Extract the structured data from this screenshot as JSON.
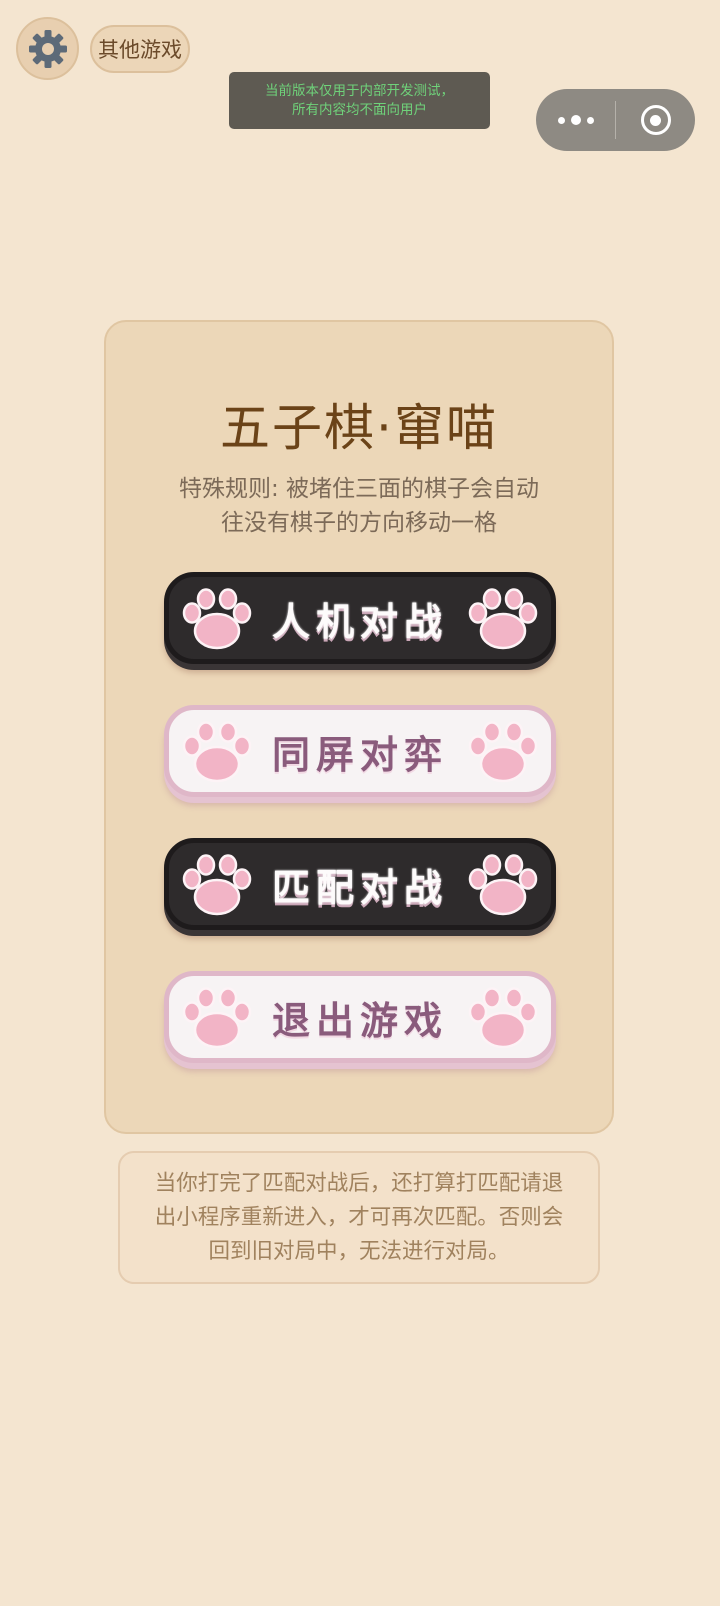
{
  "top_bar": {
    "other_games_label": "其他游戏",
    "test_notice_line1": "当前版本仅用于内部开发测试，",
    "test_notice_line2": "所有内容均不面向用户"
  },
  "panel": {
    "title": "五子棋·窜喵",
    "rule_line1": "特殊规则: 被堵住三面的棋子会自动",
    "rule_line2": "往没有棋子的方向移动一格",
    "buttons": [
      {
        "label": "人机对战",
        "style": "dark"
      },
      {
        "label": "同屏对弈",
        "style": "light"
      },
      {
        "label": "匹配对战",
        "style": "dark"
      },
      {
        "label": "退出游戏",
        "style": "light"
      }
    ]
  },
  "tip": {
    "line1": "当你打完了匹配对战后，还打算打匹配请退",
    "line2": "出小程序重新进入，才可再次匹配。否则会",
    "line3": "回到旧对局中，无法进行对局。"
  },
  "colors": {
    "background": "#f4e5d0",
    "panel": "#ecd7b8",
    "paw_pink": "#f2b4c6",
    "title_brown": "#6b4318"
  },
  "icons": [
    "gear-icon",
    "more-dots-icon",
    "close-target-icon",
    "paw-icon"
  ]
}
